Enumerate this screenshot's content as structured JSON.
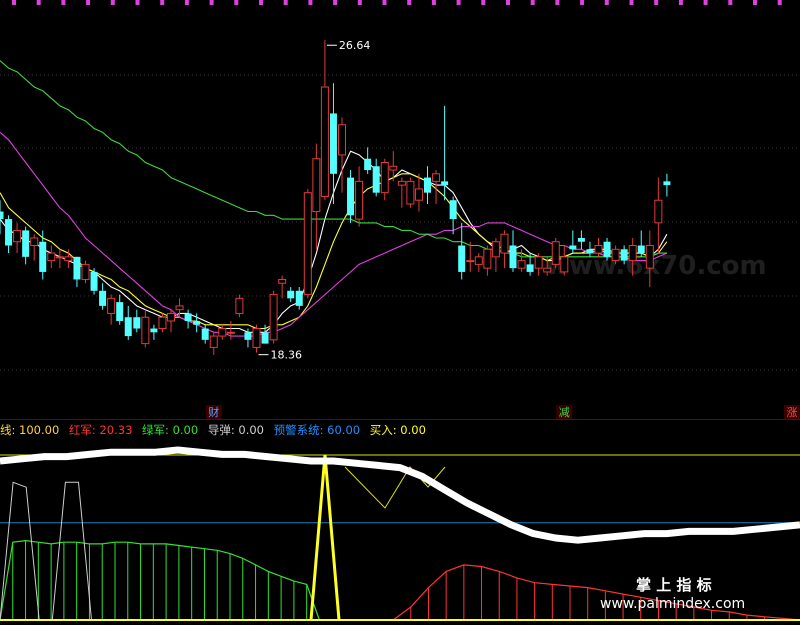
{
  "chart_data": [
    {
      "type": "candlestick",
      "title": "",
      "ylim": [
        17.0,
        27.6
      ],
      "candles": [
        [
          22.1,
          22.4,
          21.5,
          21.9
        ],
        [
          21.9,
          22.0,
          21.0,
          21.2
        ],
        [
          21.3,
          21.8,
          21.0,
          21.6
        ],
        [
          21.6,
          21.7,
          20.7,
          20.9
        ],
        [
          21.2,
          21.5,
          20.8,
          21.4
        ],
        [
          21.3,
          21.6,
          20.3,
          20.5
        ],
        [
          20.8,
          21.2,
          20.6,
          21.0
        ],
        [
          20.9,
          21.1,
          20.6,
          20.9
        ],
        [
          20.8,
          21.1,
          20.6,
          20.9
        ],
        [
          20.9,
          20.9,
          20.1,
          20.3
        ],
        [
          20.3,
          20.8,
          20.2,
          20.7
        ],
        [
          20.5,
          20.6,
          19.9,
          20.0
        ],
        [
          20.0,
          20.2,
          19.5,
          19.6
        ],
        [
          19.4,
          19.9,
          19.1,
          19.8
        ],
        [
          19.7,
          19.9,
          19.1,
          19.2
        ],
        [
          19.3,
          19.6,
          18.7,
          18.8
        ],
        [
          19.3,
          19.5,
          18.9,
          19.0
        ],
        [
          18.6,
          19.5,
          18.5,
          19.3
        ],
        [
          19.0,
          19.1,
          18.7,
          18.9
        ],
        [
          19.0,
          19.4,
          18.9,
          19.3
        ],
        [
          19.2,
          19.5,
          18.9,
          19.4
        ],
        [
          19.5,
          19.8,
          19.3,
          19.6
        ],
        [
          19.4,
          19.5,
          19.0,
          19.2
        ],
        [
          19.2,
          19.4,
          18.9,
          19.1
        ],
        [
          19.0,
          19.1,
          18.6,
          18.7
        ],
        [
          18.5,
          18.9,
          18.3,
          18.8
        ],
        [
          18.8,
          19.1,
          18.7,
          19.0
        ],
        [
          18.9,
          19.2,
          18.7,
          18.9
        ],
        [
          19.4,
          19.9,
          19.3,
          19.8
        ],
        [
          18.9,
          19.0,
          18.5,
          18.7
        ],
        [
          18.5,
          19.1,
          18.36,
          19.0
        ],
        [
          18.9,
          19.1,
          18.6,
          18.6
        ],
        [
          18.7,
          20.0,
          18.6,
          19.9
        ],
        [
          20.2,
          20.4,
          19.8,
          20.3
        ],
        [
          20.0,
          20.1,
          19.7,
          19.8
        ],
        [
          20.0,
          20.1,
          19.5,
          19.6
        ],
        [
          19.9,
          22.7,
          19.8,
          22.6
        ],
        [
          22.1,
          23.9,
          21.1,
          23.5
        ],
        [
          22.5,
          26.64,
          22.4,
          25.4
        ],
        [
          24.7,
          25.5,
          22.3,
          23.1
        ],
        [
          23.6,
          24.6,
          22.6,
          24.4
        ],
        [
          23.0,
          23.2,
          21.8,
          22.0
        ],
        [
          21.9,
          23.3,
          21.7,
          22.9
        ],
        [
          23.5,
          23.8,
          23.1,
          23.2
        ],
        [
          23.3,
          23.5,
          22.5,
          22.6
        ],
        [
          22.6,
          23.5,
          22.4,
          23.4
        ],
        [
          23.2,
          23.7,
          22.9,
          23.3
        ],
        [
          22.8,
          23.0,
          22.2,
          22.9
        ],
        [
          22.3,
          23.0,
          22.2,
          22.9
        ],
        [
          22.4,
          23.1,
          22.1,
          22.7
        ],
        [
          23.0,
          23.3,
          22.3,
          22.6
        ],
        [
          22.9,
          23.2,
          22.3,
          23.1
        ],
        [
          22.9,
          24.9,
          22.4,
          22.8
        ],
        [
          22.4,
          22.5,
          21.5,
          21.9
        ],
        [
          21.2,
          21.8,
          20.3,
          20.5
        ],
        [
          20.8,
          21.3,
          20.5,
          20.8
        ],
        [
          20.7,
          21.0,
          20.5,
          20.9
        ],
        [
          20.6,
          21.2,
          20.4,
          21.1
        ],
        [
          20.9,
          21.4,
          20.5,
          21.3
        ],
        [
          21.0,
          21.6,
          20.6,
          21.5
        ],
        [
          21.2,
          21.6,
          20.5,
          20.6
        ],
        [
          20.6,
          21.1,
          20.5,
          20.8
        ],
        [
          20.7,
          21.0,
          20.4,
          20.5
        ],
        [
          20.6,
          21.0,
          20.4,
          20.9
        ],
        [
          20.5,
          20.9,
          20.4,
          20.6
        ],
        [
          20.7,
          21.4,
          20.6,
          21.3
        ],
        [
          20.5,
          21.2,
          20.4,
          20.9
        ],
        [
          21.2,
          21.6,
          21.0,
          21.1
        ],
        [
          21.4,
          21.6,
          21.1,
          21.3
        ],
        [
          21.1,
          21.3,
          20.9,
          21.0
        ],
        [
          21.0,
          21.4,
          20.9,
          21.2
        ],
        [
          21.3,
          21.4,
          20.8,
          20.9
        ],
        [
          20.8,
          21.2,
          20.7,
          21.1
        ],
        [
          21.1,
          21.2,
          20.7,
          20.8
        ],
        [
          20.8,
          21.4,
          20.4,
          21.2
        ],
        [
          21.2,
          21.6,
          20.9,
          21.0
        ],
        [
          20.6,
          21.6,
          20.1,
          21.2
        ],
        [
          21.8,
          23.0,
          21.0,
          22.4
        ],
        [
          22.9,
          23.1,
          22.5,
          22.8
        ]
      ],
      "up_color": "#e23a3a",
      "down_color": "#54ffff",
      "ma_lines": [
        {
          "color": "#ffffff",
          "values": [
            21.9,
            21.6,
            21.5,
            21.3,
            21.3,
            21.1,
            21.0,
            20.9,
            20.8,
            20.7,
            20.6,
            20.5,
            20.3,
            20.1,
            20.0,
            19.8,
            19.6,
            19.5,
            19.4,
            19.3,
            19.3,
            19.4,
            19.4,
            19.3,
            19.2,
            19.1,
            19.0,
            19.0,
            19.0,
            18.9,
            18.9,
            18.9,
            19.1,
            19.4,
            19.6,
            19.7,
            20.3,
            21.0,
            21.9,
            22.6,
            23.2,
            23.7,
            23.6,
            23.4,
            23.2,
            22.9,
            23.0,
            23.2,
            23.1,
            23.0,
            22.9,
            22.8,
            22.8,
            22.6,
            22.2,
            21.8,
            21.5,
            21.3,
            21.1,
            21.0,
            21.1,
            21.2,
            21.0,
            20.9,
            20.8,
            20.8,
            20.9,
            21.0,
            21.0,
            21.1,
            21.1,
            21.1,
            21.0,
            21.0,
            21.0,
            21.0,
            20.9,
            21.1,
            21.5
          ]
        },
        {
          "color": "#ffff33",
          "values": [
            22.6,
            22.2,
            22.0,
            21.8,
            21.6,
            21.4,
            21.3,
            21.1,
            21.0,
            20.8,
            20.6,
            20.5,
            20.4,
            20.3,
            20.1,
            20.0,
            19.8,
            19.6,
            19.5,
            19.4,
            19.3,
            19.3,
            19.2,
            19.2,
            19.1,
            19.1,
            19.1,
            19.1,
            19.1,
            19.1,
            19.0,
            19.0,
            19.1,
            19.1,
            19.2,
            19.3,
            19.6,
            20.1,
            20.7,
            21.3,
            21.8,
            22.2,
            22.5,
            22.7,
            22.8,
            22.9,
            23.0,
            23.1,
            23.1,
            23.0,
            22.9,
            22.7,
            22.5,
            22.2,
            21.9,
            21.7,
            21.5,
            21.3,
            21.2,
            21.1,
            21.0,
            21.0,
            20.9,
            20.9,
            20.8,
            20.9,
            20.9,
            21.0,
            21.0,
            21.0,
            21.1,
            21.0,
            21.0,
            21.0,
            21.0,
            21.0,
            20.9,
            21.0,
            21.3
          ]
        },
        {
          "color": "#e040e0",
          "values": [
            24.2,
            24.0,
            23.7,
            23.4,
            23.1,
            22.8,
            22.5,
            22.2,
            22.0,
            21.7,
            21.4,
            21.2,
            21.0,
            20.8,
            20.6,
            20.4,
            20.2,
            20.0,
            19.8,
            19.6,
            19.5,
            19.3,
            19.2,
            19.1,
            19.0,
            18.9,
            18.9,
            18.8,
            18.8,
            18.8,
            18.8,
            18.9,
            18.9,
            19.0,
            19.1,
            19.3,
            19.5,
            19.7,
            19.9,
            20.1,
            20.3,
            20.5,
            20.7,
            20.8,
            20.9,
            21.0,
            21.1,
            21.2,
            21.3,
            21.4,
            21.5,
            21.5,
            21.6,
            21.6,
            21.7,
            21.7,
            21.7,
            21.8,
            21.8,
            21.8,
            21.7,
            21.6,
            21.5,
            21.4,
            21.3,
            21.2,
            21.2,
            21.1,
            21.1,
            21.0,
            21.0,
            20.9,
            20.9,
            20.9,
            20.8,
            20.8,
            20.8,
            20.9,
            21.0
          ]
        },
        {
          "color": "#3ed83e",
          "values": [
            26.1,
            25.9,
            25.8,
            25.6,
            25.4,
            25.3,
            25.1,
            24.9,
            24.8,
            24.6,
            24.5,
            24.3,
            24.2,
            24.0,
            23.9,
            23.7,
            23.6,
            23.4,
            23.3,
            23.2,
            23.0,
            22.9,
            22.8,
            22.7,
            22.6,
            22.5,
            22.4,
            22.3,
            22.2,
            22.1,
            22.1,
            22.0,
            22.0,
            21.9,
            21.9,
            21.9,
            21.9,
            21.9,
            21.9,
            21.9,
            21.9,
            21.9,
            21.8,
            21.8,
            21.8,
            21.7,
            21.7,
            21.6,
            21.6,
            21.5,
            21.5,
            21.4,
            21.4,
            21.3,
            21.3,
            21.2,
            21.2,
            21.1,
            21.1,
            21.0,
            21.0,
            20.9,
            20.9,
            20.9,
            20.9,
            20.9,
            20.9,
            20.9,
            20.9,
            20.9,
            20.9,
            20.9,
            20.9,
            20.9,
            20.9,
            20.9,
            20.9,
            21.0,
            21.0
          ]
        }
      ],
      "annotations": {
        "high": {
          "label": "26.64",
          "index": 38
        },
        "low": {
          "label": "18.36",
          "index": 30
        }
      },
      "markers": [
        {
          "label": "财",
          "index": 25,
          "color": "#4fa3ff"
        },
        {
          "label": "减",
          "index": 66,
          "color": "#3ed83e"
        },
        {
          "label": "涨",
          "index": 94,
          "color": "#ff4a4a"
        }
      ]
    },
    {
      "type": "indicator",
      "legend": [
        {
          "label": "线: 100.00",
          "color": "#ffd23a"
        },
        {
          "label": "红军: 20.33",
          "color": "#ff3333"
        },
        {
          "label": "绿军: 0.00",
          "color": "#33e033"
        },
        {
          "label": "导弹: 0.00",
          "color": "#cfcfcf"
        },
        {
          "label": "预警系统: 60.00",
          "color": "#1e90ff"
        },
        {
          "label": "买入: 0.00",
          "color": "#ffff22"
        }
      ],
      "ylim": [
        0,
        100
      ],
      "reference_lines": [
        {
          "value": 100,
          "color": "#e0e000"
        },
        {
          "value": 60,
          "color": "#1e7fbf"
        }
      ],
      "green_army": [
        0,
        48,
        49,
        48,
        47,
        48,
        48,
        47,
        47,
        48,
        48,
        47,
        47,
        47,
        46,
        45,
        44,
        43,
        41,
        38,
        34,
        30,
        27,
        24,
        22,
        0,
        0,
        0
      ],
      "red_army": [
        0,
        0,
        0,
        0,
        8,
        20,
        30,
        34,
        33,
        30,
        26,
        23,
        22,
        21,
        20,
        18,
        16,
        14,
        12,
        10,
        8,
        6,
        5,
        3,
        2,
        1,
        0
      ],
      "missile": [
        0,
        85,
        82,
        0,
        0,
        85,
        85,
        0,
        0,
        0,
        0,
        0,
        0,
        0
      ],
      "buy_signal_index": 40,
      "white_line": [
        95,
        96,
        97,
        97,
        98,
        99,
        99,
        99,
        100,
        99,
        98,
        98,
        97,
        96,
        95,
        95,
        94,
        93,
        92,
        88,
        82,
        76,
        71,
        66,
        62,
        60,
        59,
        60,
        61,
        62,
        62,
        63,
        63,
        63,
        64,
        65,
        66
      ]
    }
  ],
  "watermark": {
    "faint_text": "www.6x70.com",
    "brand_cn": "掌 上 指 标",
    "brand_url": "www.palmindex.com"
  },
  "top_markers_color": "#e040e0"
}
